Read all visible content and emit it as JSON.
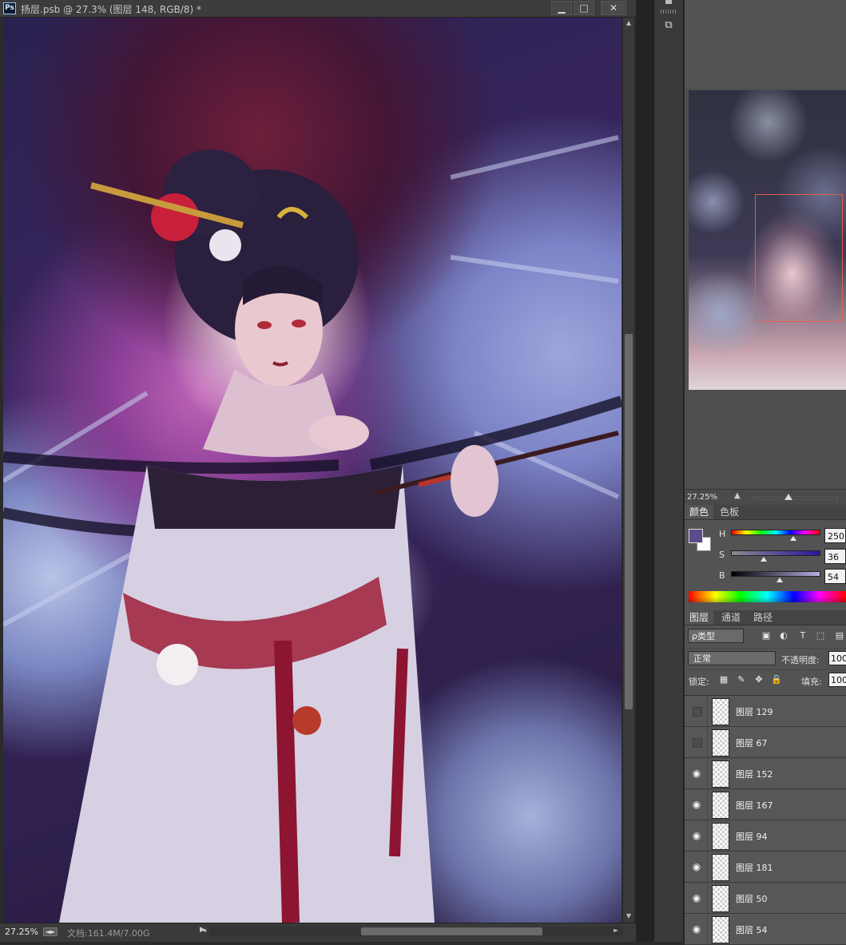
{
  "document": {
    "app_badge": "Ps",
    "title": "扬层.psb @ 27.3% (图层 148, RGB/8) *",
    "window_buttons": {
      "minimize": "▁",
      "maximize": "□",
      "close": "✕"
    }
  },
  "status_bar": {
    "zoom": "27.25%",
    "doc_info": "文档:161.4M/7.00G",
    "menu_arrow": "▶"
  },
  "navigator": {
    "zoom_text": "27.25%"
  },
  "color_panel": {
    "tabs": [
      "颜色",
      "色板"
    ],
    "active_tab": "颜色",
    "foreground_color": "#5c4b8a",
    "background_color": "#ffffff",
    "sliders": [
      {
        "label": "H",
        "value": "250"
      },
      {
        "label": "S",
        "value": "36"
      },
      {
        "label": "B",
        "value": "54"
      }
    ]
  },
  "layers_panel": {
    "tabs": [
      "图层",
      "通道",
      "路径"
    ],
    "active_tab": "图层",
    "filter_label": "ρ类型",
    "blend_mode": "正常",
    "opacity_label": "不透明度:",
    "opacity_value": "100",
    "lock_label": "锁定:",
    "fill_label": "填充:",
    "fill_value": "100",
    "layers": [
      {
        "name": "图层 129",
        "visible": false
      },
      {
        "name": "图层 67",
        "visible": false
      },
      {
        "name": "图层 152",
        "visible": true
      },
      {
        "name": "图层 167",
        "visible": true
      },
      {
        "name": "图层 94",
        "visible": true
      },
      {
        "name": "图层 181",
        "visible": true
      },
      {
        "name": "图层 50",
        "visible": true
      },
      {
        "name": "图层 54",
        "visible": true
      }
    ]
  }
}
